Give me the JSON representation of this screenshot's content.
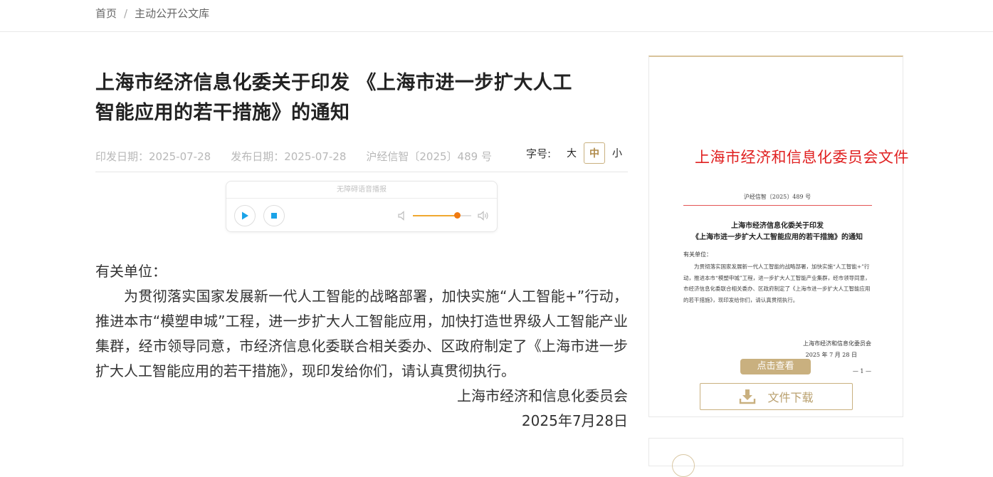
{
  "breadcrumb": {
    "home": "首页",
    "separator": "/",
    "current": "主动公开公文库"
  },
  "article": {
    "title_line1": "上海市经济信息化委关于印发 《上海市进一步扩大人工",
    "title_line2": "智能应用的若干措施》的通知",
    "issue_date": "印发日期：2025-07-28",
    "publish_date": "发布日期：2025-07-28",
    "doc_number": "沪经信智〔2025〕489 号",
    "font_size": {
      "label": "字号:",
      "large": "大",
      "medium": "中",
      "small": "小",
      "selected": "中"
    },
    "salutation": "有关单位：",
    "paragraph": "为贯彻落实国家发展新一代人工智能的战略部署，加快实施“人工智能+”行动，推进本市“模塑申城”工程，进一步扩大人工智能应用，加快打造世界级人工智能产业集群，经市领导同意，市经济信息化委联合相关委办、区政府制定了《上海市进一步扩大人工智能应用的若干措施》，现印发给你们，请认真贯彻执行。",
    "signature": "上海市经济和信息化委员会",
    "date": "2025年7月28日"
  },
  "player": {
    "title": "无障碍语音播报",
    "volume": 0.75,
    "colors": {
      "accent": "#f07a10"
    }
  },
  "sidebar": {
    "preview": {
      "org_header": "上海市经济和信息化委员会文件",
      "doc_number": "沪经信智〔2025〕489 号",
      "title_line1": "上海市经济信息化委关于印发",
      "title_line2": "《上海市进一步扩大人工智能应用的若干措施》的通知",
      "salutation": "有关单位：",
      "paragraph": "为贯彻落实国家发展新一代人工智能的战略部署，加快实施“人工智能+”行动，推进本市“模塑申城”工程，进一步扩大人工智能产业集群，经市领导同意，市经济信息化委联合相关委办、区政府制定了《上海市进一步扩大人工智能应用的若干措施》，现印发给你们，请认真贯彻执行。",
      "signature": "上海市经济和信息化委员会",
      "date": "2025 年 7 月 28 日",
      "page": "— 1 —"
    },
    "view_button": "点击查看",
    "download_button": "文件下载",
    "colors": {
      "gold": "#c9b07f",
      "red": "#e02020"
    }
  }
}
